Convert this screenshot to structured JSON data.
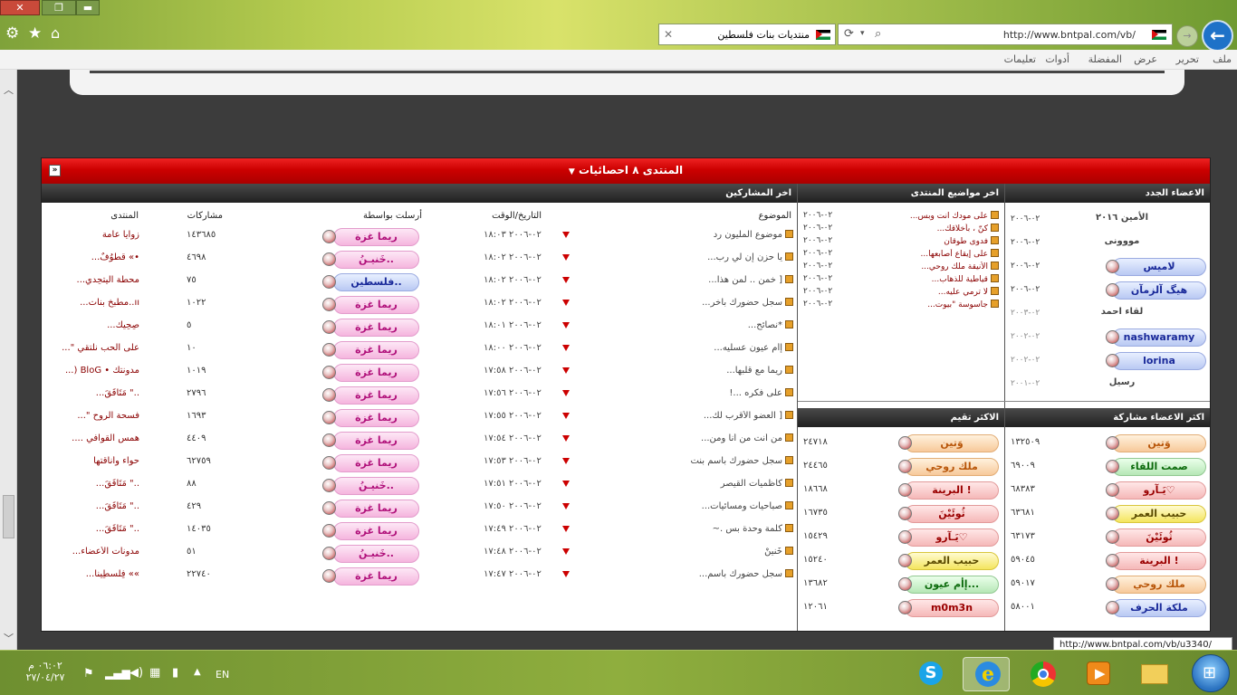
{
  "browser": {
    "window_buttons": {
      "close": "✕",
      "restore": "❐",
      "minimize": "▬"
    },
    "address": "http://www.bntpal.com/vb/",
    "tab_title": "منتديات بنات فلسطين",
    "tab_close": "✕",
    "menu": [
      "ملف",
      "تحرير",
      "عرض",
      "المفضلة",
      "أدوات",
      "تعليمات"
    ]
  },
  "panel": {
    "title": "المنتدى ٨ احصائيات",
    "collapse_symbol": "«"
  },
  "sections": {
    "latest_posts": "اخر المشاركين",
    "latest_topics": "اخر مواضيع المنتدى",
    "new_members": "الاعضاء الجدد",
    "top_posters": "اكثر الاعضاء مشاركة",
    "top_rated": "الاكثر تقيم"
  },
  "posts_headers": {
    "subject": "الموضوع",
    "datetime": "التاريخ/الوقت",
    "sender": "أرسلت بواسطة",
    "posts": "مشاركات",
    "forum": "المنتدى"
  },
  "posts": [
    {
      "subject": "موضوع المليون رد",
      "date": "٠٢-٢٠٠٦ ١٨:٠٣",
      "sender": "ريما غزة",
      "style": "pink",
      "count": "١٤٣٦٨٥",
      "forum": "زوايا عامة"
    },
    {
      "subject": "يا حزن إن لي رب...",
      "date": "٠٢-٢٠٠٦ ١٨:٠٢",
      "sender": "خَنيـنُ..",
      "style": "pink",
      "count": "٤٦٩٨",
      "forum": "•» قطوُفٌ..."
    },
    {
      "subject": "[ خمن .. لمن هذآ...",
      "date": "٠٢-٢٠٠٦ ١٨:٠٢",
      "sender": "فلسطين..",
      "style": "blue",
      "count": "٧٥",
      "forum": "محطة آليتحِدي..."
    },
    {
      "subject": "سجل حضورك بأخر...",
      "date": "٠٢-٢٠٠٦ ١٨:٠٢",
      "sender": "ريما غزة",
      "style": "pink",
      "count": "١٠٢٢",
      "forum": "ıı..مطبخ بنات..."
    },
    {
      "subject": "*نصائح...",
      "date": "٠٢-٢٠٠٦ ١٨:٠١",
      "sender": "ريما غزة",
      "style": "pink",
      "count": "٥",
      "forum": "صِحِيك..."
    },
    {
      "subject": "إأم عيون عسليه...",
      "date": "٠٢-٢٠٠٦ ١٨:٠٠",
      "sender": "ريما غزة",
      "style": "pink",
      "count": "١٠",
      "forum": "على الحب نلتقي \"..."
    },
    {
      "subject": "ريماً مع قلبها...",
      "date": "٠٢-٢٠٠٦ ١٧:٥٨",
      "sender": "ريما غزة",
      "style": "pink",
      "count": "١٠١٩",
      "forum": "مدونتك • BloG (..."
    },
    {
      "subject": "على فكره ...!",
      "date": "٠٢-٢٠٠٦ ١٧:٥٦",
      "sender": "ريما غزة",
      "style": "pink",
      "count": "٢٧٩٦",
      "forum": "..\" مَتَأَفَقَ..."
    },
    {
      "subject": "[ العضو الأقرب لك...",
      "date": "٠٢-٢٠٠٦ ١٧:٥٥",
      "sender": "ريما غزة",
      "style": "pink",
      "count": "١٦٩٣",
      "forum": "فسحة الروح \"..."
    },
    {
      "subject": "من أنت من أنا ومن...",
      "date": "٠٢-٢٠٠٦ ١٧:٥٤",
      "sender": "ريما غزة",
      "style": "pink",
      "count": "٤٤٠٩",
      "forum": "همس القوافي ...."
    },
    {
      "subject": "سجل حضورك بأسم بنت",
      "date": "٠٢-٢٠٠٦ ١٧:٥٣",
      "sender": "ريما غزة",
      "style": "pink",
      "count": "٦٢٧٥٩",
      "forum": "حواء وأناقتها"
    },
    {
      "subject": "كاظميات القيصر",
      "date": "٠٢-٢٠٠٦ ١٧:٥١",
      "sender": "خَنيـنُ..",
      "style": "pink",
      "count": "٨٨",
      "forum": "..\" مَتَأَفَقَ..."
    },
    {
      "subject": "صباحيات ومسائيات...",
      "date": "٠٢-٢٠٠٦ ١٧:٥٠",
      "sender": "ريما غزة",
      "style": "pink",
      "count": "٤٢٩",
      "forum": "..\" مَتَأَفَقَ..."
    },
    {
      "subject": "كلمة وحدة بس .~",
      "date": "٠٢-٢٠٠٦ ١٧:٤٩",
      "sender": "ريما غزة",
      "style": "pink",
      "count": "١٤٠٣٥",
      "forum": "..\" مَتَأَفَقَ..."
    },
    {
      "subject": "خَنينْ",
      "date": "٠٢-٢٠٠٦ ١٧:٤٨",
      "sender": "خَنيـنُ..",
      "style": "pink",
      "count": "٥١",
      "forum": "مدونات الأعضاء..."
    },
    {
      "subject": "سجل حضورك باسم...",
      "date": "٠٢-٢٠٠٦ ١٧:٤٧",
      "sender": "ريما غزة",
      "style": "pink",
      "count": "٢٢٧٤٠",
      "forum": "»» فِلسطِينا..."
    }
  ],
  "topics": [
    {
      "title": "على مودك انت وبس...",
      "date": "٠٢-٢٠٠٦"
    },
    {
      "title": "كنّ ، بأخلاقك...",
      "date": "٠٢-٢٠٠٦"
    },
    {
      "title": "فدوى طوقان",
      "date": "٠٢-٢٠٠٦"
    },
    {
      "title": "على إيقاع أصابعها...",
      "date": "٠٢-٢٠٠٦"
    },
    {
      "title": "الأنيقة ملك روحي...",
      "date": "٠٢-٢٠٠٦"
    },
    {
      "title": "قياطية للذهاب...",
      "date": "٠٢-٢٠٠٦"
    },
    {
      "title": "لا ترمي عليه...",
      "date": "٠٢-٢٠٠٦"
    },
    {
      "title": "جاسوسة \"بيوت...",
      "date": "٠٢-٢٠٠٦"
    }
  ],
  "new_members": [
    {
      "name": "الأمين ٢٠١٦",
      "date": "٠٢-٢٠٠٦",
      "style": "none"
    },
    {
      "name": "مووونى",
      "date": "٠٢-٢٠٠٦",
      "style": "none"
    },
    {
      "name": "لاميس",
      "date": "٠٢-٢٠٠٦",
      "style": "blue"
    },
    {
      "name": "هيگ آلزمآن",
      "date": "٠٢-٢٠٠٦",
      "style": "blue"
    },
    {
      "name": "لقاء احمد",
      "date": "٠٢-٢٠٠٣",
      "style": "none"
    },
    {
      "name": "nashwaramy",
      "date": "٠٢-٢٠٠٢",
      "style": "blue"
    },
    {
      "name": "lorina",
      "date": "٠٢-٢٠٠٢",
      "style": "blue"
    },
    {
      "name": "رسيل",
      "date": "٠٢-٢٠٠١",
      "style": "none"
    }
  ],
  "top_posters": [
    {
      "name": "وَتين",
      "count": "١٣٢٥٠٩",
      "style": "orange"
    },
    {
      "name": "صمت اللقاء",
      "count": "٦٩٠٠٩",
      "style": "green"
    },
    {
      "name": "يَـآرو♡",
      "count": "٦٨٣٨٣",
      "style": "red"
    },
    {
      "name": "حبيب العمر",
      "count": "٦٣٦٨١",
      "style": "yellow"
    },
    {
      "name": "ثُوئَيْنَ",
      "count": "٦٣١٧٣",
      "style": "red"
    },
    {
      "name": "البرينة !",
      "count": "٥٩٠٤٥",
      "style": "red"
    },
    {
      "name": "ملك روحي",
      "count": "٥٩٠١٧",
      "style": "orange"
    },
    {
      "name": "ملكة الحرف",
      "count": "٥٨٠٠١",
      "style": "blue"
    }
  ],
  "top_rated": [
    {
      "name": "وَتين",
      "count": "٢٤٧١٨",
      "style": "orange"
    },
    {
      "name": "ملك روحي",
      "count": "٢٤٤٦٥",
      "style": "orange"
    },
    {
      "name": "البرينة !",
      "count": "١٨٦٦٨",
      "style": "red"
    },
    {
      "name": "ثُوئَيْنَ",
      "count": "١٦٧٣٥",
      "style": "red"
    },
    {
      "name": "يَـآرو♡",
      "count": "١٥٤٢٩",
      "style": "red"
    },
    {
      "name": "حبيب العمر",
      "count": "١٥٢٤٠",
      "style": "yellow"
    },
    {
      "name": "إأم عيون...",
      "count": "١٣٦٨٢",
      "style": "green"
    },
    {
      "name": "m0m3n",
      "count": "١٢٠٦١",
      "style": "red"
    }
  ],
  "status_url": "http://www.bntpal.com/vb/u3340/",
  "taskbar": {
    "time": "٠٦:٠٢ م",
    "date": "٢٧/٠٤/٢٧",
    "lang": "EN",
    "apps": [
      "skype-icon",
      "ie-icon",
      "chrome-icon",
      "media-player-icon",
      "explorer-icon"
    ]
  }
}
